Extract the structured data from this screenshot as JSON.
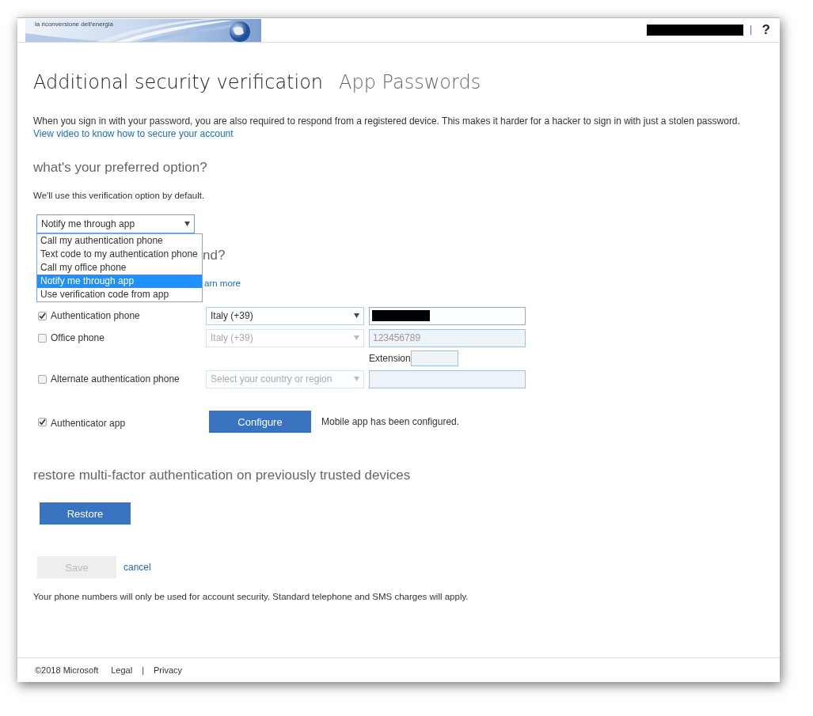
{
  "header": {
    "logo_text": "la riconversione dell'energia",
    "user_redacted": true,
    "help": "?"
  },
  "tabs": [
    {
      "label": "Additional security verification",
      "selected": true
    },
    {
      "label": "App Passwords",
      "selected": false
    }
  ],
  "intro": {
    "text": "When you sign in with your password, you are also required to respond from a registered device. This makes it harder for a hacker to sign in with just a stolen password.",
    "link": "View video to know how to secure your account"
  },
  "preferred": {
    "heading": "what's your preferred option?",
    "note": "We'll use this verification option by default.",
    "dropdown": {
      "value": "Notify me through app",
      "expanded": true,
      "options": [
        {
          "label": "Call my authentication phone",
          "selected": false
        },
        {
          "label": "Text code to my authentication phone",
          "selected": false
        },
        {
          "label": "Call my office phone",
          "selected": false
        },
        {
          "label": "Notify me through app",
          "selected": true
        },
        {
          "label": "Use verification code from app",
          "selected": false
        }
      ]
    }
  },
  "respond": {
    "heading_end": "nd?",
    "link_end": "arn more"
  },
  "methods": [
    {
      "kind": "phone",
      "label": "Authentication phone",
      "checked": true,
      "disabled": false,
      "country": "Italy (+39)",
      "redacted": true
    },
    {
      "kind": "phone",
      "label": "Office phone",
      "checked": false,
      "disabled": true,
      "country": "Italy (+39)",
      "number": "123456789",
      "extension_label": "Extension"
    },
    {
      "kind": "phone",
      "label": "Alternate authentication phone",
      "checked": false,
      "disabled": true,
      "country_placeholder": "Select your country or region"
    },
    {
      "kind": "app",
      "label": "Authenticator app",
      "checked": true,
      "button": "Configure",
      "status": "Mobile app has been configured."
    }
  ],
  "restore": {
    "heading": "restore multi-factor authentication on previously trusted devices",
    "button": "Restore"
  },
  "actions": {
    "save": {
      "label": "Save",
      "disabled": true
    },
    "cancel": "cancel"
  },
  "disclaimer": "Your phone numbers will only be used for account security. Standard telephone and SMS charges will apply.",
  "footer": {
    "copyright": "©2018 Microsoft",
    "links": [
      "Legal",
      "Privacy"
    ],
    "separator": "|"
  }
}
